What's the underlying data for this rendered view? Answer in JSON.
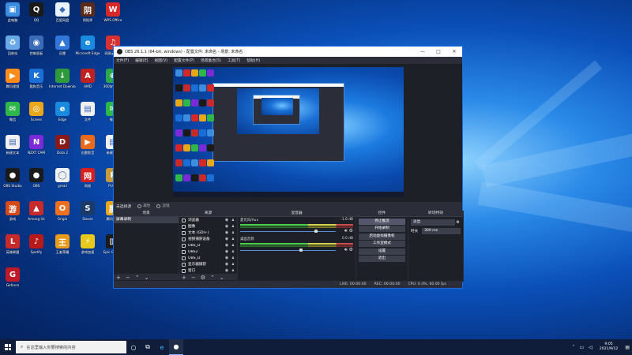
{
  "desktop": {
    "icons": [
      {
        "label": "此电脑",
        "glyph": "▣",
        "color": "#3b8de0"
      },
      {
        "label": "QQ",
        "glyph": "Q",
        "color": "#1a1a1a"
      },
      {
        "label": "百度网盘",
        "glyph": "◆",
        "color": "#e8f2ff"
      },
      {
        "label": "阴阳师",
        "glyph": "阴",
        "color": "#5a2b1a"
      },
      {
        "label": "WPS Office",
        "glyph": "W",
        "color": "#d62828"
      },
      {
        "label": "回收站",
        "glyph": "♻",
        "color": "#6aa9e8"
      },
      {
        "label": "控制面板",
        "glyph": "◉",
        "color": "#3a6ab8"
      },
      {
        "label": "迅雷",
        "glyph": "▲",
        "color": "#3277d8"
      },
      {
        "label": "Microsoft Edge",
        "glyph": "e",
        "color": "#1a8adf"
      },
      {
        "label": "网易云音乐",
        "glyph": "♫",
        "color": "#d63030"
      },
      {
        "label": "腾讯视频",
        "glyph": "▶",
        "color": "#ff8c1a"
      },
      {
        "label": "酷狗音乐",
        "glyph": "K",
        "color": "#1a6fd6"
      },
      {
        "label": "Internet Download",
        "glyph": "↓",
        "color": "#2f9a3a"
      },
      {
        "label": "AMD",
        "glyph": "A",
        "color": "#c02020"
      },
      {
        "label": "360安全卫士",
        "glyph": "⊕",
        "color": "#2aa84a"
      },
      {
        "label": "微信",
        "glyph": "✉",
        "color": "#2fb84a"
      },
      {
        "label": "Screen",
        "glyph": "◎",
        "color": "#e8a81a"
      },
      {
        "label": "Edge",
        "glyph": "e",
        "color": "#1a8adf"
      },
      {
        "label": "文件",
        "glyph": "▤",
        "color": "#f0f0f0"
      },
      {
        "label": "微信",
        "glyph": "✉",
        "color": "#2fb84a"
      },
      {
        "label": "新建文本",
        "glyph": "▤",
        "color": "#f0f0f0"
      },
      {
        "label": "NZXT CAM",
        "glyph": "N",
        "color": "#7a2ad6"
      },
      {
        "label": "Dota 2",
        "glyph": "D",
        "color": "#8a1a1a"
      },
      {
        "label": "迅雷影音",
        "glyph": "▶",
        "color": "#e86a1a"
      },
      {
        "label": "新建文本",
        "glyph": "▤",
        "color": "#f0f0f0"
      },
      {
        "label": "OBS Studio",
        "glyph": "●",
        "color": "#1a1a1a"
      },
      {
        "label": "OBS",
        "glyph": "●",
        "color": "#1a1a1a"
      },
      {
        "label": "gmail",
        "glyph": "◯",
        "color": "#f0f0f0"
      },
      {
        "label": "网易",
        "glyph": "网",
        "color": "#d62020"
      },
      {
        "label": "PUBG",
        "glyph": "P",
        "color": "#c89a3a"
      },
      {
        "label": "游戏",
        "glyph": "游",
        "color": "#d64a1a"
      },
      {
        "label": "Among Us",
        "glyph": "▲",
        "color": "#c82a2a"
      },
      {
        "label": "Origin",
        "glyph": "O",
        "color": "#f07020"
      },
      {
        "label": "Steam",
        "glyph": "S",
        "color": "#1a3a6a"
      },
      {
        "label": "腾讯游戏",
        "glyph": "腾",
        "color": "#e8a81a"
      },
      {
        "label": "英雄联盟",
        "glyph": "L",
        "color": "#c82a2a"
      },
      {
        "label": "Spotify",
        "glyph": "♪",
        "color": "#b81a1a"
      },
      {
        "label": "王者荣耀",
        "glyph": "王",
        "color": "#e89a1a"
      },
      {
        "label": "游戏加速",
        "glyph": "⚡",
        "color": "#e8c81a"
      },
      {
        "label": "Epic Games",
        "glyph": "▥",
        "color": "#1a1a1a"
      },
      {
        "label": "Geforce",
        "glyph": "G",
        "color": "#c01a2a"
      }
    ]
  },
  "obs": {
    "title": "OBS 26.1.1 (64-bit, windows) - 配置文件: 未命名 - 场景: 未命名",
    "menu": [
      "文件(F)",
      "编辑(E)",
      "视图(V)",
      "配置文件(P)",
      "场景集合(S)",
      "工具(T)",
      "帮助(H)"
    ],
    "scene_status": {
      "no_source": "未选择源",
      "properties": "属性",
      "filters": "滤镜"
    },
    "docks": {
      "scenes_title": "场景",
      "sources_title": "来源",
      "mixer_title": "混音器",
      "controls_title": "控件",
      "transitions_title": "转场特效"
    },
    "scenes": [
      "屏幕录制"
    ],
    "sources": [
      "浏览器",
      "图像",
      "文本 (GDI+)",
      "视频捕获设备",
      "OBS_D",
      "OBS2",
      "OBS_D",
      "显示器捕获",
      "窗口"
    ],
    "mixer": [
      {
        "name": "麦克风/Aux",
        "db": "-1.6 dB",
        "level": 0.78
      },
      {
        "name": "桌面音频",
        "db": "0.0 dB",
        "level": 0.62
      }
    ],
    "controls": [
      "停止推流",
      "开始录制",
      "启动虚拟摄像机",
      "工作室模式",
      "设置",
      "退出"
    ],
    "transitions": {
      "type": "淡出",
      "duration_label": "时长",
      "duration": "300 ms"
    },
    "statusbar": {
      "live": "LIVE: 00:00:00",
      "rec": "REC: 00:00:00",
      "cpu": "CPU: 0.4%, 60.00 fps"
    }
  },
  "taskbar": {
    "search_placeholder": "在这里输入你要搜索的内容",
    "time": "9:05",
    "date": "2021/9/12"
  }
}
